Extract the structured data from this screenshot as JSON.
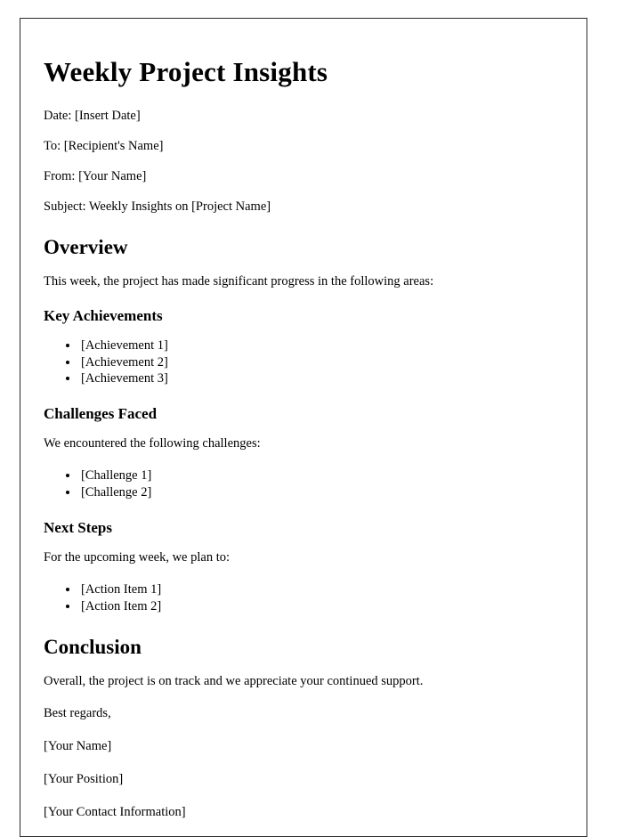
{
  "document": {
    "title": "Weekly Project Insights",
    "meta": {
      "date_line": "Date: [Insert Date]",
      "to_line": "To: [Recipient's Name]",
      "from_line": "From: [Your Name]",
      "subject_line": "Subject: Weekly Insights on [Project Name]"
    },
    "overview": {
      "heading": "Overview",
      "intro": "This week, the project has made significant progress in the following areas:",
      "achievements": {
        "heading": "Key Achievements",
        "items": [
          "[Achievement 1]",
          "[Achievement 2]",
          "[Achievement 3]"
        ]
      },
      "challenges": {
        "heading": "Challenges Faced",
        "intro": "We encountered the following challenges:",
        "items": [
          "[Challenge 1]",
          "[Challenge 2]"
        ]
      },
      "next_steps": {
        "heading": "Next Steps",
        "intro": "For the upcoming week, we plan to:",
        "items": [
          "[Action Item 1]",
          "[Action Item 2]"
        ]
      }
    },
    "conclusion": {
      "heading": "Conclusion",
      "body": "Overall, the project is on track and we appreciate your continued support.",
      "closing": "Best regards,",
      "signature_name": "[Your Name]",
      "signature_position": "[Your Position]",
      "signature_contact": "[Your Contact Information]"
    }
  }
}
